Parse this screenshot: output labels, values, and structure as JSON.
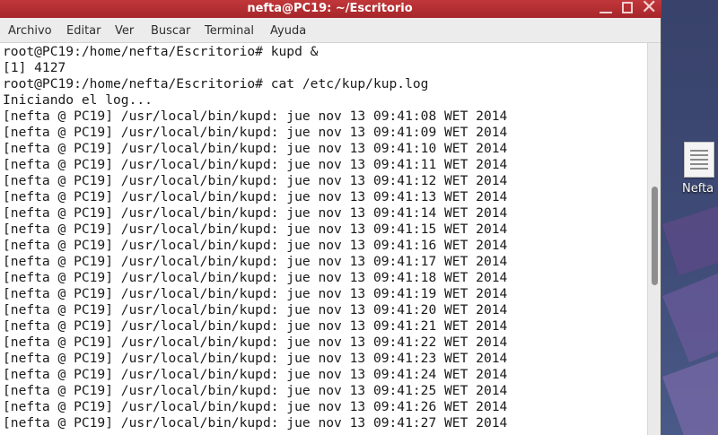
{
  "window": {
    "title": "nefta@PC19: ~/Escritorio"
  },
  "menu": {
    "items": [
      "Archivo",
      "Editar",
      "Ver",
      "Buscar",
      "Terminal",
      "Ayuda"
    ]
  },
  "terminal": {
    "lines": [
      "root@PC19:/home/nefta/Escritorio# kupd &",
      "[1] 4127",
      "root@PC19:/home/nefta/Escritorio# cat /etc/kup/kup.log",
      "Iniciando el log...",
      "[nefta @ PC19] /usr/local/bin/kupd: jue nov 13 09:41:08 WET 2014",
      "[nefta @ PC19] /usr/local/bin/kupd: jue nov 13 09:41:09 WET 2014",
      "[nefta @ PC19] /usr/local/bin/kupd: jue nov 13 09:41:10 WET 2014",
      "[nefta @ PC19] /usr/local/bin/kupd: jue nov 13 09:41:11 WET 2014",
      "[nefta @ PC19] /usr/local/bin/kupd: jue nov 13 09:41:12 WET 2014",
      "[nefta @ PC19] /usr/local/bin/kupd: jue nov 13 09:41:13 WET 2014",
      "[nefta @ PC19] /usr/local/bin/kupd: jue nov 13 09:41:14 WET 2014",
      "[nefta @ PC19] /usr/local/bin/kupd: jue nov 13 09:41:15 WET 2014",
      "[nefta @ PC19] /usr/local/bin/kupd: jue nov 13 09:41:16 WET 2014",
      "[nefta @ PC19] /usr/local/bin/kupd: jue nov 13 09:41:17 WET 2014",
      "[nefta @ PC19] /usr/local/bin/kupd: jue nov 13 09:41:18 WET 2014",
      "[nefta @ PC19] /usr/local/bin/kupd: jue nov 13 09:41:19 WET 2014",
      "[nefta @ PC19] /usr/local/bin/kupd: jue nov 13 09:41:20 WET 2014",
      "[nefta @ PC19] /usr/local/bin/kupd: jue nov 13 09:41:21 WET 2014",
      "[nefta @ PC19] /usr/local/bin/kupd: jue nov 13 09:41:22 WET 2014",
      "[nefta @ PC19] /usr/local/bin/kupd: jue nov 13 09:41:23 WET 2014",
      "[nefta @ PC19] /usr/local/bin/kupd: jue nov 13 09:41:24 WET 2014",
      "[nefta @ PC19] /usr/local/bin/kupd: jue nov 13 09:41:25 WET 2014",
      "[nefta @ PC19] /usr/local/bin/kupd: jue nov 13 09:41:26 WET 2014",
      "[nefta @ PC19] /usr/local/bin/kupd: jue nov 13 09:41:27 WET 2014"
    ]
  },
  "desktop": {
    "icon_label": "Nefta",
    "icon_name": "text-document-icon"
  },
  "colors": {
    "titlebar": "#b3303a",
    "menubar": "#ececec",
    "terminal_bg": "#ffffff",
    "terminal_fg": "#1a1a1a",
    "desktop": "#3f4b73"
  }
}
